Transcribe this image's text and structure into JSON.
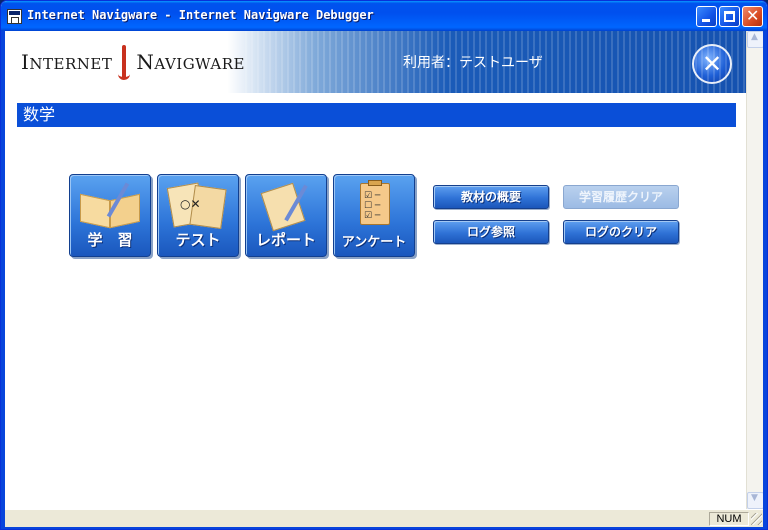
{
  "window": {
    "title": "Internet Navigware - Internet Navigware Debugger"
  },
  "header": {
    "logo_left_cap": "I",
    "logo_left_rest": "NTERNET",
    "logo_right_cap": "N",
    "logo_right_rest": "AVIGWARE",
    "user_label": "利用者：テストユーザ"
  },
  "subject": {
    "title": "数学"
  },
  "big_buttons": [
    {
      "label": "学　習",
      "icon": "book-icon"
    },
    {
      "label": "テスト",
      "icon": "test-paper-icon"
    },
    {
      "label": "レポート",
      "icon": "report-icon"
    },
    {
      "label": "アンケート",
      "icon": "survey-clipboard-icon"
    }
  ],
  "small_buttons": {
    "overview": "教材の概要",
    "clear_history": "学習履歴クリア",
    "log_view": "ログ参照",
    "log_clear": "ログのクリア"
  },
  "test_marks": "○✕",
  "survey_checks": "☑ ─\n☐ ─\n☑ ─",
  "statusbar": {
    "num": "NUM"
  }
}
